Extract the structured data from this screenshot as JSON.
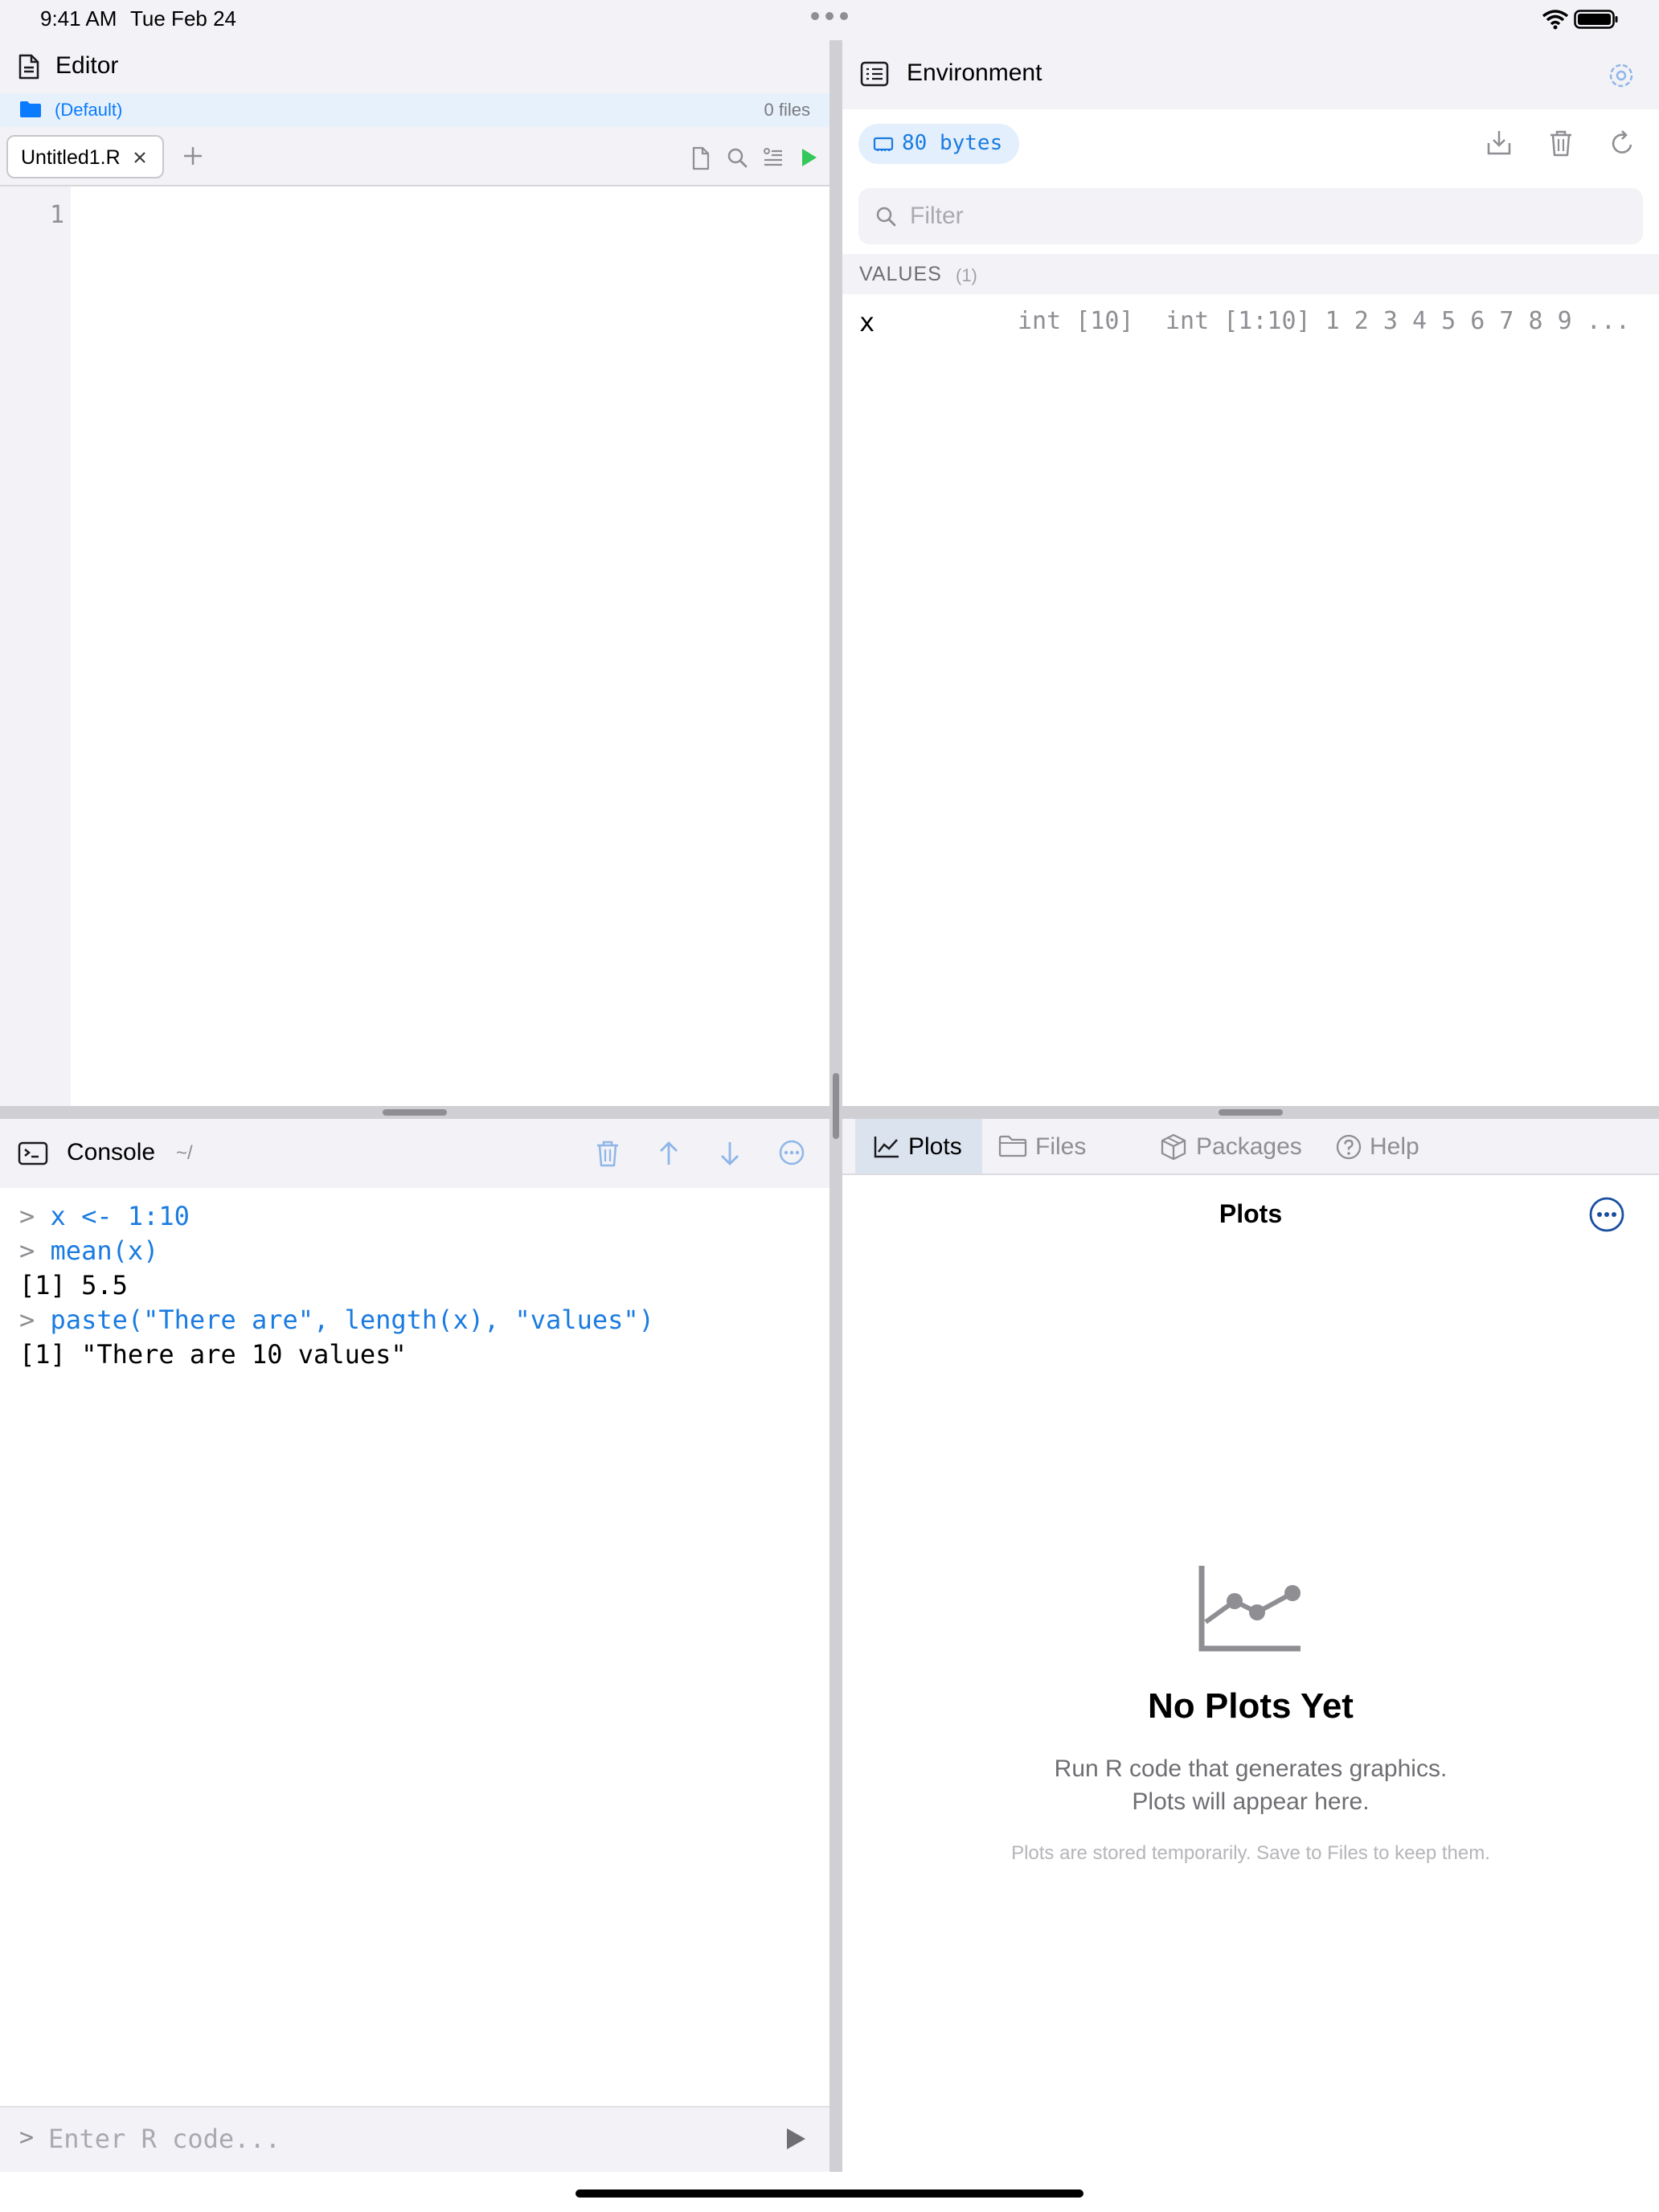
{
  "status_bar": {
    "time": "9:41 AM",
    "date": "Tue Feb 24"
  },
  "editor": {
    "title": "Editor",
    "project": "(Default)",
    "file_count": "0 files",
    "tabs": [
      {
        "label": "Untitled1.R",
        "active": true
      }
    ],
    "line_numbers": [
      "1"
    ]
  },
  "console": {
    "title": "Console",
    "directory": "~/",
    "lines": [
      {
        "kind": "input",
        "prompt": ">",
        "text": "x <- 1:10"
      },
      {
        "kind": "input",
        "prompt": ">",
        "text": "mean(x)"
      },
      {
        "kind": "output",
        "prompt": "",
        "text": "[1] 5.5"
      },
      {
        "kind": "input",
        "prompt": ">",
        "text": "paste(\"There are\", length(x), \"values\")"
      },
      {
        "kind": "output",
        "prompt": "",
        "text": "[1] \"There are 10 values\""
      }
    ],
    "input_prompt": ">",
    "input_placeholder": "Enter R code..."
  },
  "environment": {
    "title": "Environment",
    "memory": "80 bytes",
    "filter_placeholder": "Filter",
    "values_label": "VALUES",
    "values_count": "(1)",
    "variables": [
      {
        "name": "x",
        "type": "int [10]",
        "value": "int [1:10] 1 2 3 4 5 6 7 8 9 ..."
      }
    ]
  },
  "pane_tabs": [
    {
      "label": "Plots",
      "icon": "line-chart-icon",
      "active": true
    },
    {
      "label": "Files",
      "icon": "folder-icon",
      "active": false
    },
    {
      "label": "Packages",
      "icon": "package-icon",
      "active": false
    },
    {
      "label": "Help",
      "icon": "question-circle-icon",
      "active": false
    }
  ],
  "plots": {
    "title": "Plots",
    "empty_title": "No Plots Yet",
    "empty_line1": "Run R code that generates graphics.",
    "empty_line2": "Plots will appear here.",
    "empty_note": "Plots are stored temporarily. Save to Files to keep them."
  },
  "colors": {
    "accent": "#1a7be0",
    "run_green": "#34c759",
    "panel_bg": "#f2f2f7",
    "divider": "#cfcfd4"
  }
}
